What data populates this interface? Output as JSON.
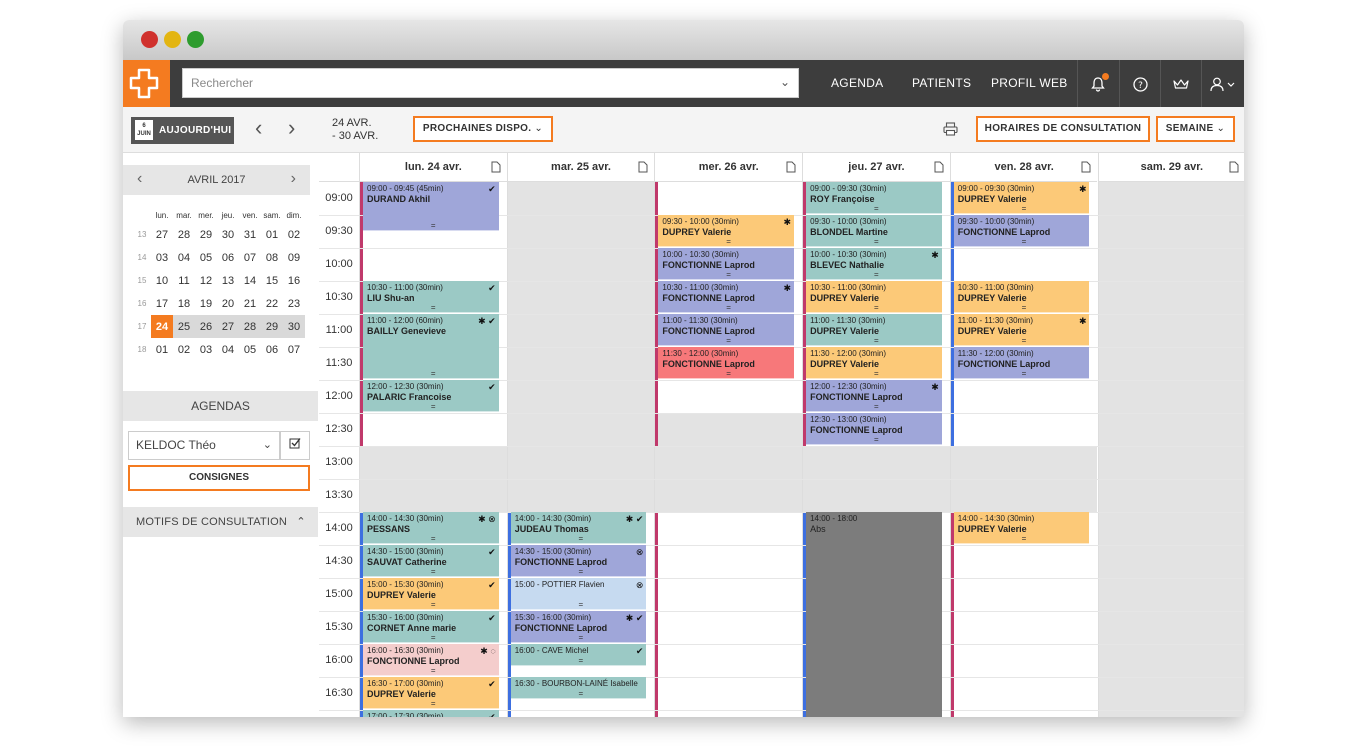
{
  "window": {
    "colors": {
      "close": "#d0312d",
      "minimize": "#e3b512",
      "maximize": "#2e9c2e"
    }
  },
  "header": {
    "search_placeholder": "Rechercher",
    "nav": [
      "AGENDA",
      "PATIENTS",
      "PROFIL WEB"
    ],
    "icons": [
      "bell-icon",
      "help-icon",
      "crown-icon",
      "user-icon"
    ],
    "accent": "#f47b20"
  },
  "toolbar": {
    "today_day": "6",
    "today_month": "JUIN",
    "today_label": "AUJOURD'HUI",
    "range_line1": "24 AVR.",
    "range_line2": "- 30 AVR.",
    "prochaines": "PROCHAINES DISPO.",
    "horaires": "HORAIRES DE CONSULTATION",
    "semaine": "SEMAINE"
  },
  "sidebar": {
    "month_title": "AVRIL 2017",
    "weekdays": [
      "lun.",
      "mar.",
      "mer.",
      "jeu.",
      "ven.",
      "sam.",
      "dim."
    ],
    "weeks": [
      {
        "num": "13",
        "days": [
          "27",
          "28",
          "29",
          "30",
          "31",
          "01",
          "02"
        ]
      },
      {
        "num": "14",
        "days": [
          "03",
          "04",
          "05",
          "06",
          "07",
          "08",
          "09"
        ]
      },
      {
        "num": "15",
        "days": [
          "10",
          "11",
          "12",
          "13",
          "14",
          "15",
          "16"
        ]
      },
      {
        "num": "16",
        "days": [
          "17",
          "18",
          "19",
          "20",
          "21",
          "22",
          "23"
        ]
      },
      {
        "num": "17",
        "days": [
          "24",
          "25",
          "26",
          "27",
          "28",
          "29",
          "30"
        ]
      },
      {
        "num": "18",
        "days": [
          "01",
          "02",
          "03",
          "04",
          "05",
          "06",
          "07"
        ]
      }
    ],
    "agendas_title": "AGENDAS",
    "agenda_selected": "KELDOC Théo",
    "consignes": "CONSIGNES",
    "motifs": "MOTIFS DE CONSULTATION"
  },
  "calendar": {
    "days": [
      "lun. 24 avr.",
      "mar. 25 avr.",
      "mer. 26 avr.",
      "jeu. 27 avr.",
      "ven. 28 avr.",
      "sam. 29 avr."
    ],
    "times": [
      "09:00",
      "09:30",
      "10:00",
      "10:30",
      "11:00",
      "11:30",
      "12:00",
      "12:30",
      "13:00",
      "13:30",
      "14:00",
      "14:30",
      "15:00",
      "15:30",
      "16:00",
      "16:30"
    ],
    "appointments": [
      {
        "day": 0,
        "start": 0,
        "len": 1.5,
        "color": "purple",
        "time": "09:00 - 09:45 (45min)",
        "name": "DURAND Akhil",
        "icons": "✔"
      },
      {
        "day": 0,
        "start": 3,
        "len": 1,
        "color": "teal",
        "time": "10:30 - 11:00 (30min)",
        "name": "LIU Shu-an",
        "icons": "✔"
      },
      {
        "day": 0,
        "start": 4,
        "len": 2,
        "color": "teal",
        "time": "11:00 - 12:00 (60min)",
        "name": "BAILLY Genevieve",
        "icons": "✱ ✔"
      },
      {
        "day": 0,
        "start": 6,
        "len": 1,
        "color": "teal",
        "time": "12:00 - 12:30 (30min)",
        "name": "PALARIC Francoise",
        "icons": "✔"
      },
      {
        "day": 0,
        "start": 10,
        "len": 1,
        "color": "teal",
        "time": "14:00 - 14:30 (30min)",
        "name": "PESSANS",
        "icons": "✱ ⊗"
      },
      {
        "day": 0,
        "start": 11,
        "len": 1,
        "color": "teal",
        "time": "14:30 - 15:00 (30min)",
        "name": "SAUVAT Catherine",
        "icons": "✔"
      },
      {
        "day": 0,
        "start": 12,
        "len": 1,
        "color": "orange",
        "time": "15:00 - 15:30 (30min)",
        "name": "DUPREY Valerie",
        "icons": "✔"
      },
      {
        "day": 0,
        "start": 13,
        "len": 1,
        "color": "teal",
        "time": "15:30 - 16:00 (30min)",
        "name": "CORNET Anne marie",
        "icons": "✔"
      },
      {
        "day": 0,
        "start": 14,
        "len": 1,
        "color": "pink",
        "time": "16:00 - 16:30 (30min)",
        "name": "FONCTIONNE Laprod",
        "icons": "✱ ◌"
      },
      {
        "day": 0,
        "start": 15,
        "len": 1,
        "color": "orange",
        "time": "16:30 - 17:00 (30min)",
        "name": "DUPREY Valerie",
        "icons": "✔"
      },
      {
        "day": 0,
        "start": 16,
        "len": 1,
        "color": "teal",
        "time": "17:00 - 17:30 (30min)",
        "name": "",
        "icons": "✔"
      },
      {
        "day": 1,
        "start": 10,
        "len": 1,
        "color": "teal",
        "time": "14:00 - 14:30 (30min)",
        "name": "JUDEAU Thomas",
        "icons": "✱ ✔"
      },
      {
        "day": 1,
        "start": 11,
        "len": 1,
        "color": "purple",
        "time": "14:30 - 15:00 (30min)",
        "name": "FONCTIONNE Laprod",
        "icons": "⊗"
      },
      {
        "day": 1,
        "start": 12,
        "len": 1,
        "color": "blue",
        "time": "15:00 - POTTIER Flavien",
        "name": "",
        "icons": "⊗"
      },
      {
        "day": 1,
        "start": 13,
        "len": 1,
        "color": "purple",
        "time": "15:30 - 16:00 (30min)",
        "name": "FONCTIONNE Laprod",
        "icons": "✱ ✔"
      },
      {
        "day": 1,
        "start": 14,
        "len": 0.7,
        "color": "teal",
        "time": "16:00 - CAVE Michel",
        "name": "",
        "icons": "✔"
      },
      {
        "day": 1,
        "start": 15,
        "len": 0.7,
        "color": "teal",
        "time": "16:30 - BOURBON-LAINÉ Isabelle",
        "name": "",
        "icons": ""
      },
      {
        "day": 2,
        "start": 1,
        "len": 1,
        "color": "orange",
        "time": "09:30 - 10:00 (30min)",
        "name": "DUPREY Valerie",
        "icons": "✱"
      },
      {
        "day": 2,
        "start": 2,
        "len": 1,
        "color": "purple",
        "time": "10:00 - 10:30 (30min)",
        "name": "FONCTIONNE Laprod",
        "icons": ""
      },
      {
        "day": 2,
        "start": 3,
        "len": 1,
        "color": "purple",
        "time": "10:30 - 11:00 (30min)",
        "name": "FONCTIONNE Laprod",
        "icons": "✱"
      },
      {
        "day": 2,
        "start": 4,
        "len": 1,
        "color": "purple",
        "time": "11:00 - 11:30 (30min)",
        "name": "FONCTIONNE Laprod",
        "icons": ""
      },
      {
        "day": 2,
        "start": 5,
        "len": 1,
        "color": "red",
        "time": "11:30 - 12:00 (30min)",
        "name": "FONCTIONNE Laprod",
        "icons": ""
      },
      {
        "day": 3,
        "start": 0,
        "len": 1,
        "color": "teal",
        "time": "09:00 - 09:30 (30min)",
        "name": "ROY Françoise",
        "icons": ""
      },
      {
        "day": 3,
        "start": 1,
        "len": 1,
        "color": "teal",
        "time": "09:30 - 10:00 (30min)",
        "name": "BLONDEL Martine",
        "icons": ""
      },
      {
        "day": 3,
        "start": 2,
        "len": 1,
        "color": "teal",
        "time": "10:00 - 10:30 (30min)",
        "name": "BLEVEC Nathalie",
        "icons": "✱"
      },
      {
        "day": 3,
        "start": 3,
        "len": 1,
        "color": "orange",
        "time": "10:30 - 11:00 (30min)",
        "name": "DUPREY Valerie",
        "icons": ""
      },
      {
        "day": 3,
        "start": 4,
        "len": 1,
        "color": "teal",
        "time": "11:00 - 11:30 (30min)",
        "name": "DUPREY Valerie",
        "icons": ""
      },
      {
        "day": 3,
        "start": 5,
        "len": 1,
        "color": "orange",
        "time": "11:30 - 12:00 (30min)",
        "name": "DUPREY Valerie",
        "icons": ""
      },
      {
        "day": 3,
        "start": 6,
        "len": 1,
        "color": "purple",
        "time": "12:00 - 12:30 (30min)",
        "name": "FONCTIONNE Laprod",
        "icons": "✱"
      },
      {
        "day": 3,
        "start": 7,
        "len": 1,
        "color": "purple",
        "time": "12:30 - 13:00 (30min)",
        "name": "FONCTIONNE Laprod",
        "icons": ""
      },
      {
        "day": 3,
        "start": 10,
        "len": 7,
        "color": "dark",
        "time": "14:00 - 18:00",
        "name": "Abs",
        "icons": "",
        "plain": true
      },
      {
        "day": 4,
        "start": 0,
        "len": 1,
        "color": "orange",
        "time": "09:00 - 09:30 (30min)",
        "name": "DUPREY Valerie",
        "icons": "✱"
      },
      {
        "day": 4,
        "start": 1,
        "len": 1,
        "color": "purple",
        "time": "09:30 - 10:00 (30min)",
        "name": "FONCTIONNE Laprod",
        "icons": ""
      },
      {
        "day": 4,
        "start": 3,
        "len": 1,
        "color": "orange",
        "time": "10:30 - 11:00 (30min)",
        "name": "DUPREY Valerie",
        "icons": ""
      },
      {
        "day": 4,
        "start": 4,
        "len": 1,
        "color": "orange",
        "time": "11:00 - 11:30 (30min)",
        "name": "DUPREY Valerie",
        "icons": "✱"
      },
      {
        "day": 4,
        "start": 5,
        "len": 1,
        "color": "purple",
        "time": "11:30 - 12:00 (30min)",
        "name": "FONCTIONNE Laprod",
        "icons": ""
      },
      {
        "day": 4,
        "start": 10,
        "len": 1,
        "color": "orange",
        "time": "14:00 - 14:30 (30min)",
        "name": "DUPREY Valerie",
        "icons": ""
      }
    ]
  }
}
